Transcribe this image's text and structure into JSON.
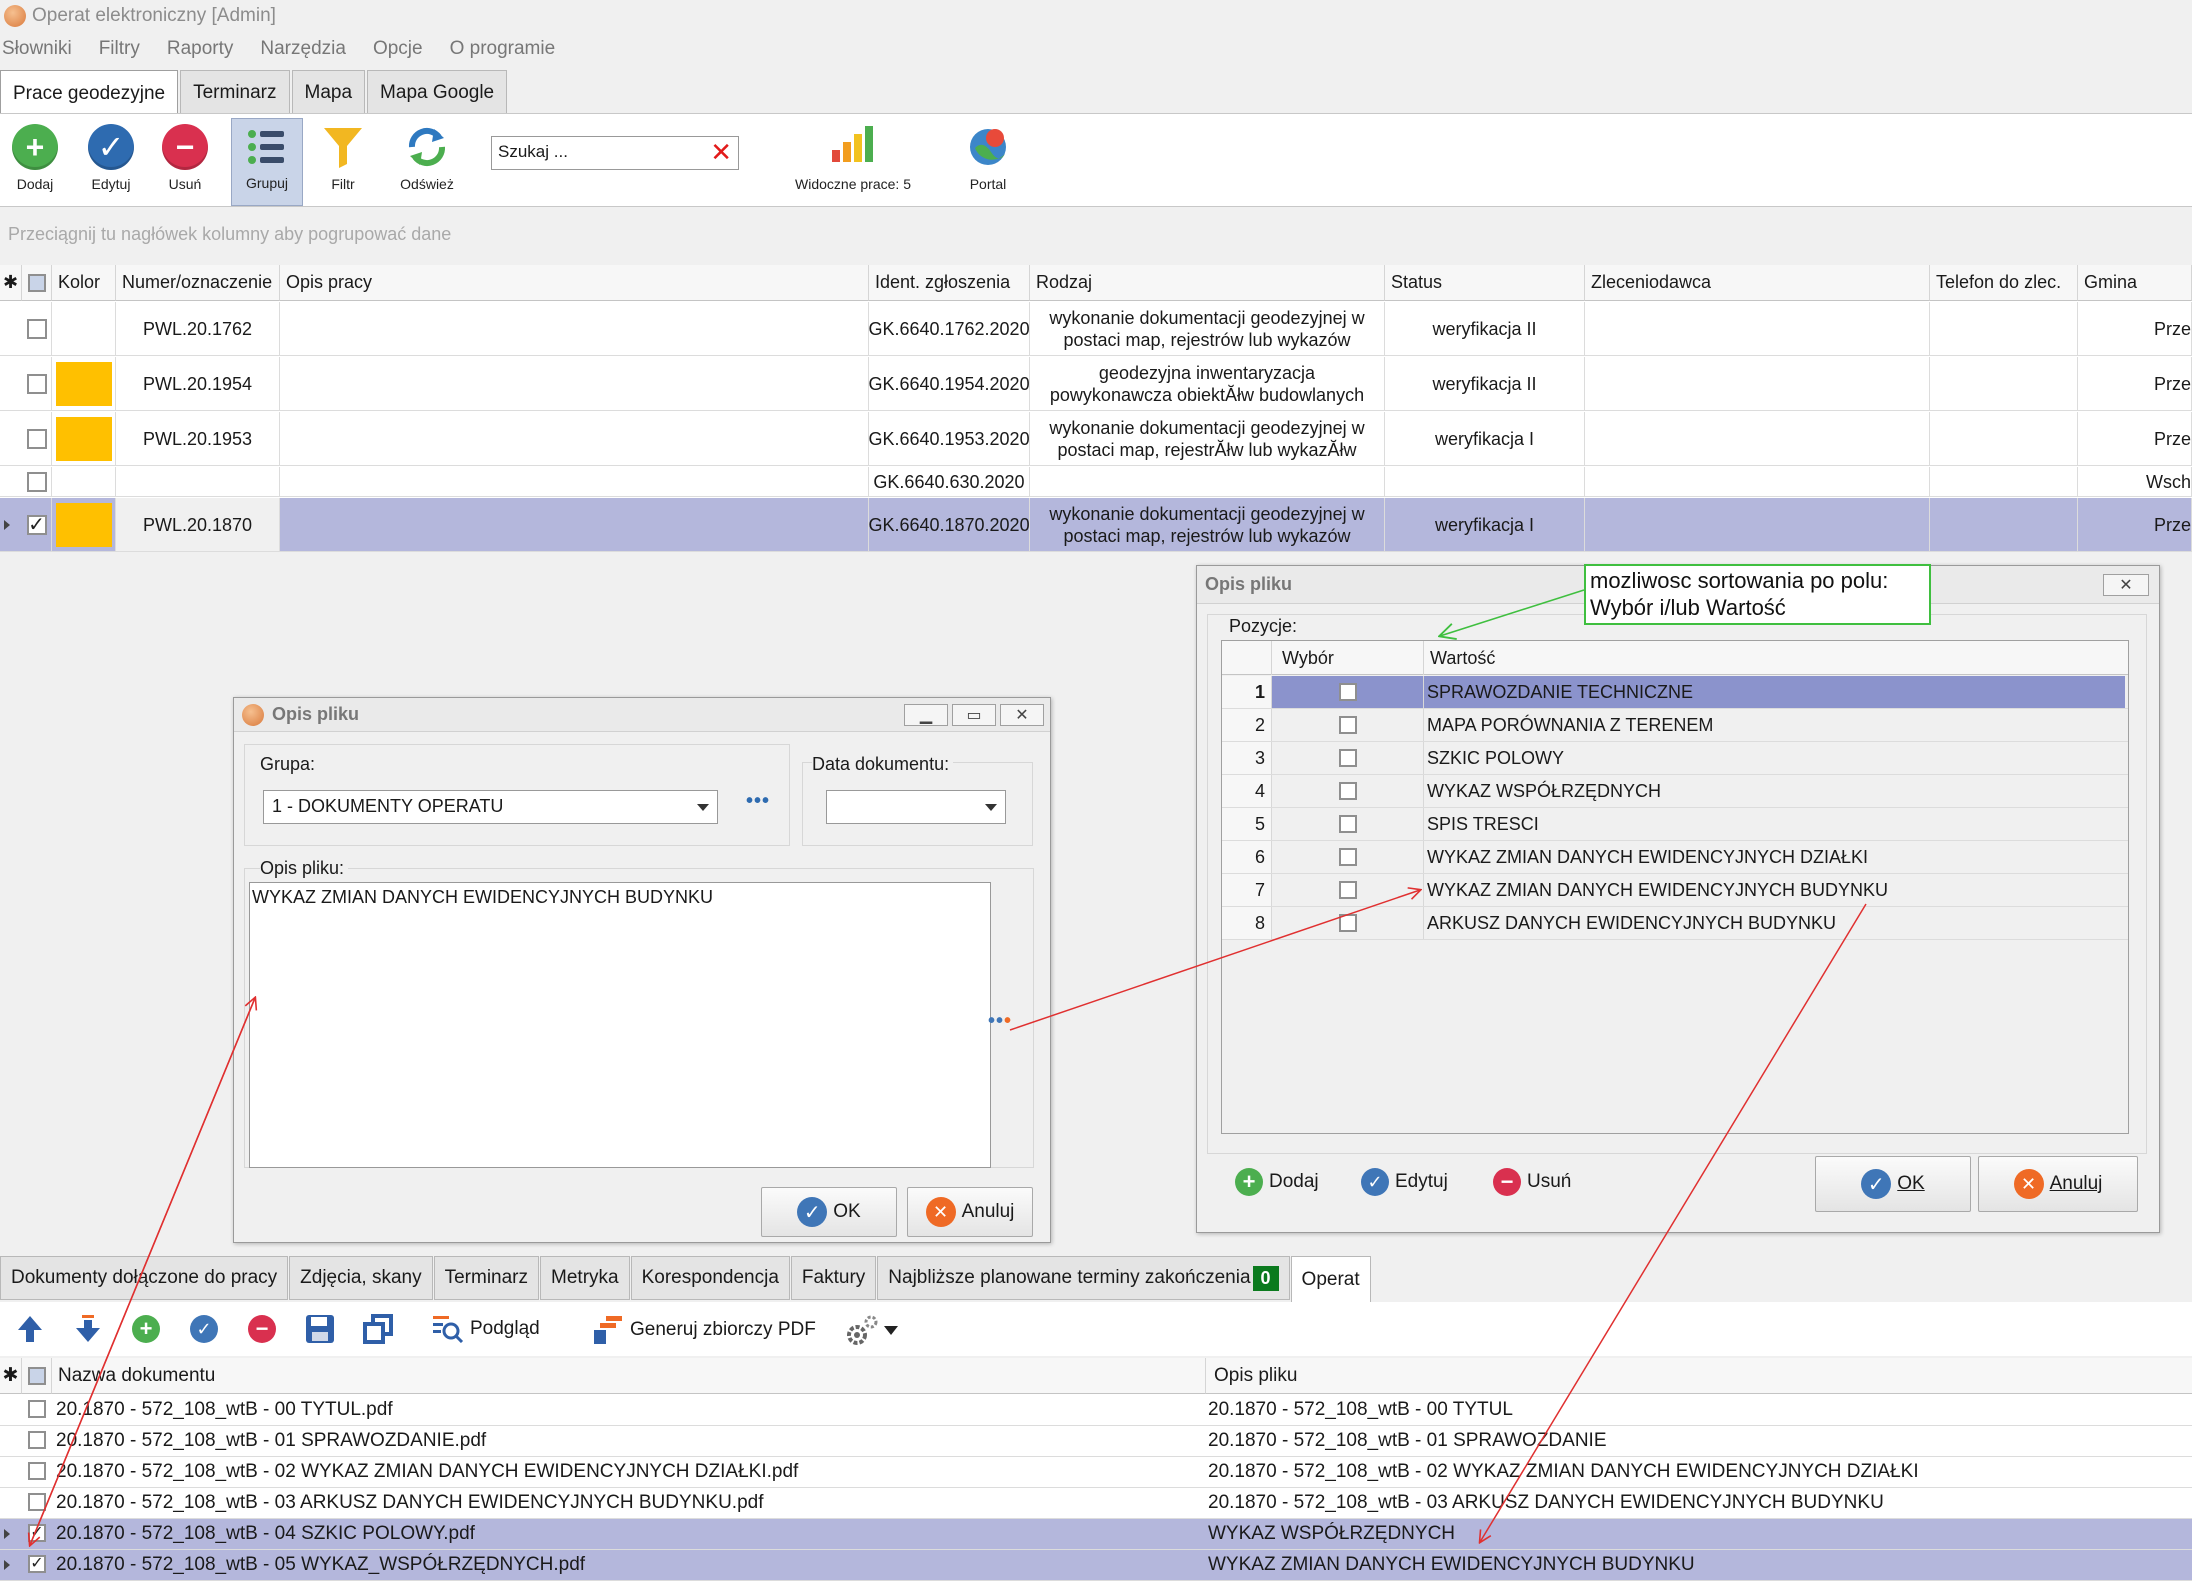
{
  "window": {
    "title": "Operat elektroniczny [Admin]"
  },
  "menu": [
    "Słowniki",
    "Filtry",
    "Raporty",
    "Narzędzia",
    "Opcje",
    "O programie"
  ],
  "top_tabs": [
    {
      "label": "Prace geodezyjne",
      "active": true
    },
    {
      "label": "Terminarz"
    },
    {
      "label": "Mapa"
    },
    {
      "label": "Mapa Google"
    }
  ],
  "ribbon": {
    "add": "Dodaj",
    "edit": "Edytuj",
    "delete": "Usuń",
    "group": "Grupuj",
    "filter": "Filtr",
    "refresh": "Odśwież",
    "search_value": "Szukaj ...",
    "visible_works": "Widoczne prace: 5",
    "portal": "Portal"
  },
  "group_hint": "Przeciągnij tu nagłówek kolumny aby pogrupować dane",
  "main_grid": {
    "headers": [
      "Kolor",
      "Numer/oznaczenie",
      "Opis pracy",
      "Ident. zgłoszenia",
      "Rodzaj",
      "Status",
      "Zleceniodawca",
      "Telefon do zlec.",
      "Gmina"
    ],
    "rows": [
      {
        "checked": false,
        "color": "",
        "number": "PWL.20.1762",
        "ident": "GK.6640.1762.2020",
        "type_l1": "wykonanie dokumentacji geodezyjnej w",
        "type_l2": "postaci map, rejestrów lub wykazów",
        "status": "weryfikacja II",
        "gmina": "Prze"
      },
      {
        "checked": false,
        "color": "#ffc000",
        "number": "PWL.20.1954",
        "ident": "GK.6640.1954.2020",
        "type_l1": "geodezyjna inwentaryzacja",
        "type_l2": "powykonawcza obiektĂłw budowlanych",
        "status": "weryfikacja II",
        "gmina": "Prze"
      },
      {
        "checked": false,
        "color": "#ffc000",
        "number": "PWL.20.1953",
        "ident": "GK.6640.1953.2020",
        "type_l1": "wykonanie dokumentacji geodezyjnej w",
        "type_l2": "postaci map, rejestrĂłw lub wykazĂłw",
        "status": "weryfikacja I",
        "gmina": "Prze"
      },
      {
        "checked": false,
        "color": "",
        "number": "",
        "ident": "GK.6640.630.2020",
        "type_l1": "",
        "type_l2": "",
        "status": "",
        "gmina": "Wsch"
      },
      {
        "checked": true,
        "color": "#ffc000",
        "number": "PWL.20.1870",
        "ident": "GK.6640.1870.2020",
        "type_l1": "wykonanie dokumentacji geodezyjnej w",
        "type_l2": "postaci map, rejestrów lub wykazów",
        "status": "weryfikacja I",
        "gmina": "Prze",
        "selected": true
      }
    ]
  },
  "left_dialog": {
    "title": "Opis pliku",
    "group_label": "Grupa:",
    "group_value": "1 - DOKUMENTY OPERATU",
    "date_label": "Data dokumentu:",
    "date_value": "",
    "desc_label": "Opis pliku:",
    "desc_value": "WYKAZ ZMIAN DANYCH EWIDENCYJNYCH BUDYNKU",
    "dots": "•••",
    "ok": "OK",
    "cancel": "Anuluj"
  },
  "right_dialog": {
    "title": "Opis pliku",
    "positions_label": "Pozycje:",
    "col_choice": "Wybór",
    "col_value": "Wartość",
    "rows": [
      {
        "n": "1",
        "value": "SPRAWOZDANIE TECHNICZNE",
        "selected": true
      },
      {
        "n": "2",
        "value": "MAPA PORÓWNANIA Z TERENEM"
      },
      {
        "n": "3",
        "value": "SZKIC POLOWY"
      },
      {
        "n": "4",
        "value": "WYKAZ WSPÓŁRZĘDNYCH"
      },
      {
        "n": "5",
        "value": "SPIS TRESCI"
      },
      {
        "n": "6",
        "value": "WYKAZ ZMIAN DANYCH EWIDENCYJNYCH DZIAŁKI"
      },
      {
        "n": "7",
        "value": "WYKAZ ZMIAN DANYCH EWIDENCYJNYCH BUDYNKU"
      },
      {
        "n": "8",
        "value": "ARKUSZ DANYCH EWIDENCYJNYCH BUDYNKU"
      }
    ],
    "add": "Dodaj",
    "edit": "Edytuj",
    "delete": "Usuń",
    "ok": "OK",
    "cancel": "Anuluj"
  },
  "annotation": {
    "line1": "mozliwosc sortowania po polu:",
    "line2": "Wybór i/lub Wartość"
  },
  "bottom_tabs": [
    {
      "label": "Dokumenty dołączone do pracy"
    },
    {
      "label": "Zdjęcia, skany"
    },
    {
      "label": "Terminarz"
    },
    {
      "label": "Metryka"
    },
    {
      "label": "Korespondencja"
    },
    {
      "label": "Faktury"
    },
    {
      "label": "Najbliższe planowane terminy zakończenia",
      "badge": "0"
    },
    {
      "label": "Operat",
      "active": true
    }
  ],
  "bottom_toolbar": {
    "preview": "Podgląd",
    "generate_pdf": "Generuj zbiorczy PDF"
  },
  "bottom_grid": {
    "col_name": "Nazwa dokumentu",
    "col_desc": "Opis pliku",
    "rows": [
      {
        "checked": false,
        "name": "20.1870 - 572_108_wtB - 00 TYTUL.pdf",
        "desc": "20.1870 - 572_108_wtB - 00 TYTUL"
      },
      {
        "checked": false,
        "name": "20.1870 - 572_108_wtB - 01 SPRAWOZDANIE.pdf",
        "desc": "20.1870 - 572_108_wtB - 01 SPRAWOZDANIE"
      },
      {
        "checked": false,
        "name": "20.1870 - 572_108_wtB - 02 WYKAZ ZMIAN DANYCH EWIDENCYJNYCH DZIAŁKI.pdf",
        "desc": "20.1870 - 572_108_wtB - 02 WYKAZ ZMIAN DANYCH EWIDENCYJNYCH DZIAŁKI"
      },
      {
        "checked": false,
        "name": "20.1870 - 572_108_wtB - 03 ARKUSZ DANYCH EWIDENCYJNYCH BUDYNKU.pdf",
        "desc": "20.1870 - 572_108_wtB - 03 ARKUSZ DANYCH EWIDENCYJNYCH BUDYNKU"
      },
      {
        "checked": true,
        "name": "20.1870 - 572_108_wtB - 04 SZKIC POLOWY.pdf",
        "desc": "WYKAZ WSPÓŁRZĘDNYCH",
        "selected": true
      },
      {
        "checked": true,
        "name": "20.1870 - 572_108_wtB - 05 WYKAZ_WSPÓŁRZĘDNYCH.pdf",
        "desc": "WYKAZ ZMIAN DANYCH EWIDENCYJNYCH BUDYNKU",
        "selected": true
      }
    ]
  },
  "colors": {
    "selection": "#b4b7dc",
    "accent_blue": "#3f76b7",
    "highlight_yellow": "#ffc000",
    "annotation_green": "#3fbf3f",
    "arrow_red": "#e03030"
  }
}
